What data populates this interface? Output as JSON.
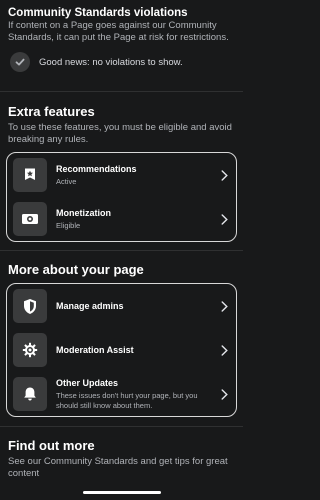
{
  "community_standards": {
    "title": "Community Standards violations",
    "description": "If content on a Page goes against our Community Standards, it can put the Page at risk for restrictions.",
    "good_news": "Good news: no violations to show."
  },
  "extra_features": {
    "title": "Extra features",
    "description": "To use these features, you must be eligible and avoid breaking any rules.",
    "items": [
      {
        "label": "Recommendations",
        "status": "Active",
        "icon": "star-badge-icon"
      },
      {
        "label": "Monetization",
        "status": "Eligible",
        "icon": "money-icon"
      }
    ]
  },
  "more_about": {
    "title": "More about your page",
    "items": [
      {
        "label": "Manage admins",
        "icon": "shield-icon"
      },
      {
        "label": "Moderation Assist",
        "icon": "gear-icon"
      },
      {
        "label": "Other Updates",
        "subtitle": "These issues don't hurt your page, but you should still know about them.",
        "icon": "bell-icon"
      }
    ]
  },
  "find_out_more": {
    "title": "Find out more",
    "description": "See our Community Standards and get tips for great content"
  },
  "colors": {
    "background": "#18191a",
    "icon_bg": "#3a3b3c",
    "text_secondary": "#b0b3b8",
    "card_border": "#d8d8d8"
  }
}
